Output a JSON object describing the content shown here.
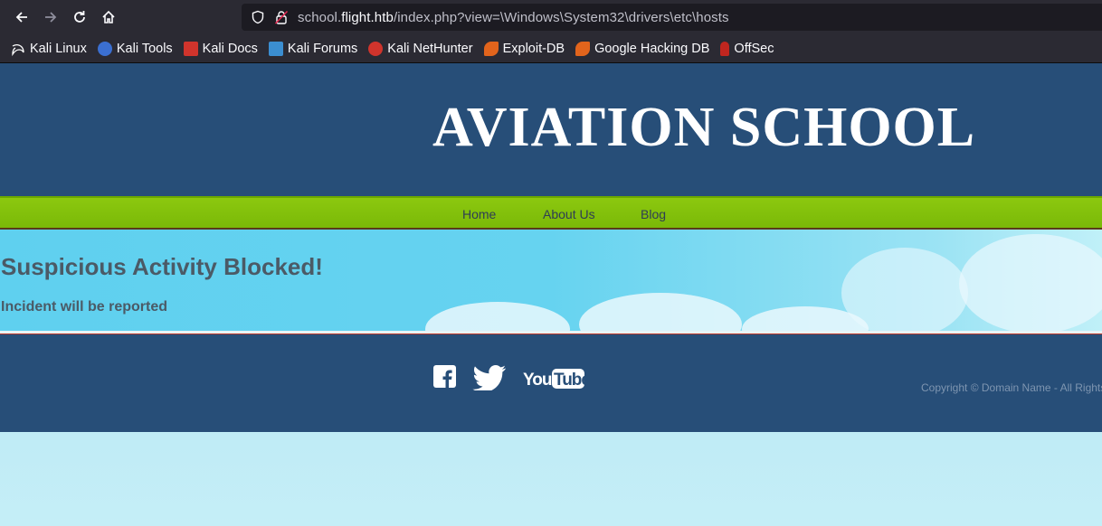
{
  "browser": {
    "url_prefix": "school.",
    "url_host": "flight.htb",
    "url_path": "/index.php?view=\\Windows\\System32\\drivers\\etc\\hosts",
    "bookmarks": [
      {
        "label": "Kali Linux",
        "icon": "kali-dragon-icon",
        "color": "#ffffff"
      },
      {
        "label": "Kali Tools",
        "icon": "kali-tools-icon",
        "color": "#3b6fd1"
      },
      {
        "label": "Kali Docs",
        "icon": "kali-docs-icon",
        "color": "#d0342c"
      },
      {
        "label": "Kali Forums",
        "icon": "kali-forums-icon",
        "color": "#3b8ed1"
      },
      {
        "label": "Kali NetHunter",
        "icon": "nethunter-icon",
        "color": "#d0342c"
      },
      {
        "label": "Exploit-DB",
        "icon": "exploit-db-icon",
        "color": "#e2641c"
      },
      {
        "label": "Google Hacking DB",
        "icon": "ghdb-icon",
        "color": "#e2641c"
      },
      {
        "label": "OffSec",
        "icon": "offsec-icon",
        "color": "#c0261f"
      }
    ]
  },
  "site": {
    "title": "AVIATION SCHOOL",
    "menu": [
      "Home",
      "About Us",
      "Blog"
    ],
    "heading": "Suspicious Activity Blocked!",
    "subheading": "Incident will be reported",
    "copyright": "Copyright © Domain Name - All Rights Reserved"
  },
  "colors": {
    "header_bg": "#274e78",
    "menu_bg": "#84c10c",
    "text_dark": "#4b5a66"
  }
}
